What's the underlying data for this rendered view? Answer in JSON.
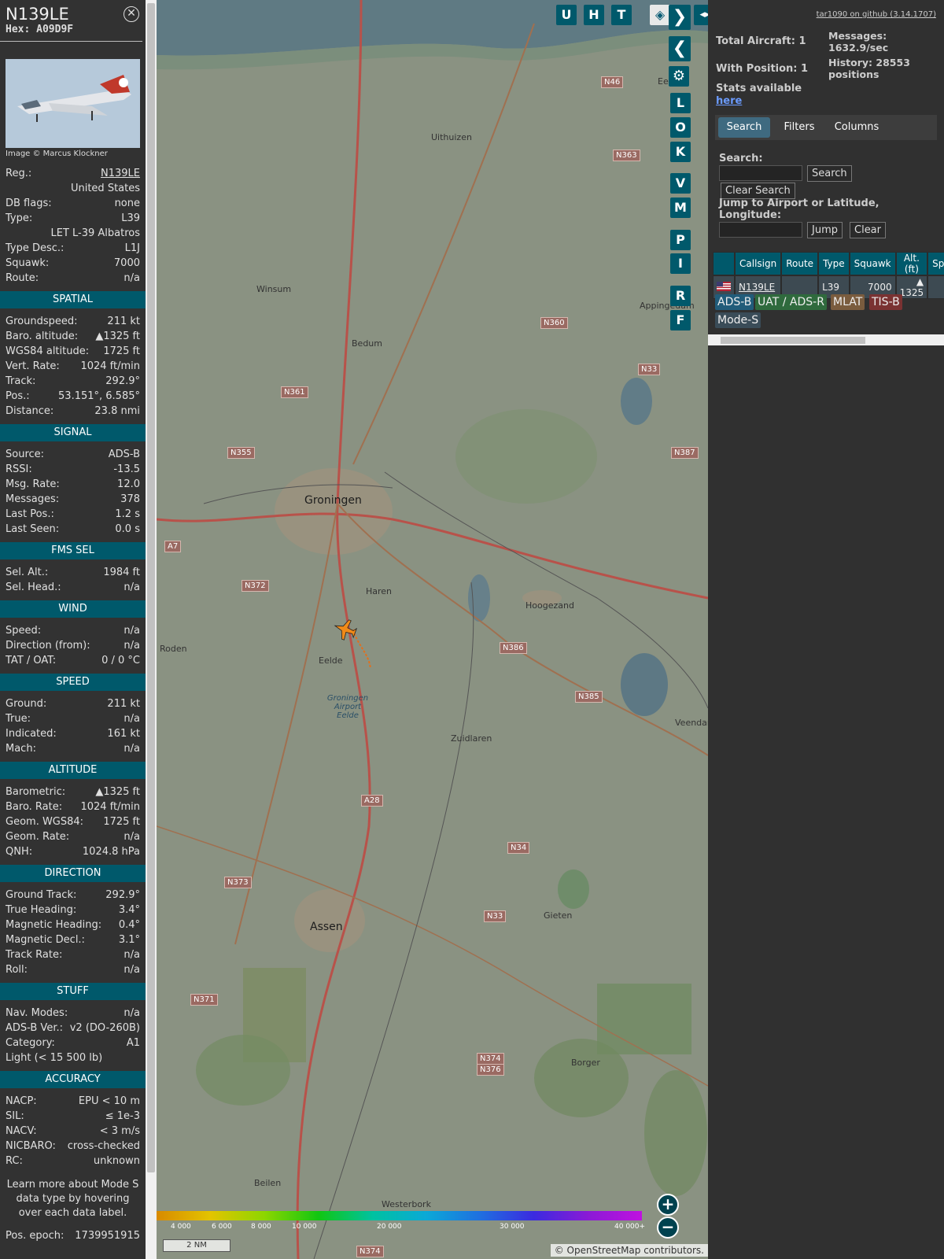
{
  "colors": {
    "accent": "#00596b",
    "panel": "#323232",
    "map_overlay": "#8d9484"
  },
  "aircraft": {
    "callsign": "N139LE",
    "hex_line": "Hex: A09D9F",
    "image_credit": "Image © Marcus Klockner",
    "basic": [
      {
        "k": "Reg.:",
        "v": "N139LE"
      },
      {
        "k": "",
        "v": "United States"
      },
      {
        "k": "DB flags:",
        "v": "none"
      },
      {
        "k": "Type:",
        "v": "L39"
      },
      {
        "k": "",
        "v": "LET L-39 Albatros"
      },
      {
        "k": "Type Desc.:",
        "v": "L1J"
      },
      {
        "k": "Squawk:",
        "v": "7000"
      },
      {
        "k": "Route:",
        "v": "n/a"
      }
    ],
    "sections": [
      {
        "title": "SPATIAL",
        "rows": [
          {
            "k": "Groundspeed:",
            "v": "211 kt"
          },
          {
            "k": "Baro. altitude:",
            "v": "▲1325 ft"
          },
          {
            "k": "WGS84 altitude:",
            "v": "1725 ft"
          },
          {
            "k": "Vert. Rate:",
            "v": "1024 ft/min"
          },
          {
            "k": "Track:",
            "v": "292.9°"
          },
          {
            "k": "Pos.:",
            "v": "53.151°, 6.585°"
          },
          {
            "k": "Distance:",
            "v": "23.8 nmi"
          }
        ]
      },
      {
        "title": "SIGNAL",
        "rows": [
          {
            "k": "Source:",
            "v": "ADS-B"
          },
          {
            "k": "RSSI:",
            "v": "-13.5"
          },
          {
            "k": "Msg. Rate:",
            "v": "12.0"
          },
          {
            "k": "Messages:",
            "v": "378"
          },
          {
            "k": "Last Pos.:",
            "v": "1.2 s"
          },
          {
            "k": "Last Seen:",
            "v": "0.0 s"
          }
        ]
      },
      {
        "title": "FMS SEL",
        "rows": [
          {
            "k": "Sel. Alt.:",
            "v": "1984 ft"
          },
          {
            "k": "Sel. Head.:",
            "v": "n/a"
          }
        ]
      },
      {
        "title": "WIND",
        "rows": [
          {
            "k": "Speed:",
            "v": "n/a"
          },
          {
            "k": "Direction (from):",
            "v": "n/a"
          },
          {
            "k": "TAT / OAT:",
            "v": "0 / 0 °C"
          }
        ]
      },
      {
        "title": "SPEED",
        "rows": [
          {
            "k": "Ground:",
            "v": "211 kt"
          },
          {
            "k": "True:",
            "v": "n/a"
          },
          {
            "k": "Indicated:",
            "v": "161 kt"
          },
          {
            "k": "Mach:",
            "v": "n/a"
          }
        ]
      },
      {
        "title": "ALTITUDE",
        "rows": [
          {
            "k": "Barometric:",
            "v": "▲1325 ft"
          },
          {
            "k": "Baro. Rate:",
            "v": "1024 ft/min"
          },
          {
            "k": "Geom. WGS84:",
            "v": "1725 ft"
          },
          {
            "k": "Geom. Rate:",
            "v": "n/a"
          },
          {
            "k": "QNH:",
            "v": "1024.8 hPa"
          }
        ]
      },
      {
        "title": "DIRECTION",
        "rows": [
          {
            "k": "Ground Track:",
            "v": "292.9°"
          },
          {
            "k": "True Heading:",
            "v": "3.4°"
          },
          {
            "k": "Magnetic Heading:",
            "v": "0.4°"
          },
          {
            "k": "Magnetic Decl.:",
            "v": "3.1°"
          },
          {
            "k": "Track Rate:",
            "v": "n/a"
          },
          {
            "k": "Roll:",
            "v": "n/a"
          }
        ]
      },
      {
        "title": "STUFF",
        "rows": [
          {
            "k": "Nav. Modes:",
            "v": "n/a"
          },
          {
            "k": "ADS-B Ver.:",
            "v": "v2 (DO-260B)"
          },
          {
            "k": "Category:",
            "v": "A1"
          },
          {
            "k": "Light (< 15 500 lb)",
            "v": ""
          }
        ]
      },
      {
        "title": "ACCURACY",
        "rows": [
          {
            "k": "NACP:",
            "v": "EPU < 10 m"
          },
          {
            "k": "SIL:",
            "v": "≤ 1e-3"
          },
          {
            "k": "NACV:",
            "v": "< 3 m/s"
          },
          {
            "k": "NICBARO:",
            "v": "cross-checked"
          },
          {
            "k": "RC:",
            "v": "unknown"
          }
        ]
      }
    ],
    "note": "Learn more about Mode S data type by hovering over each data label.",
    "pos_epoch_label": "Pos. epoch:",
    "pos_epoch_value": "1739951915"
  },
  "map": {
    "top_buttons": [
      "U",
      "H",
      "T"
    ],
    "side_buttons": [
      "L",
      "O",
      "K",
      "V",
      "M",
      "P",
      "I",
      "R",
      "F"
    ],
    "cities": [
      {
        "name": "Groningen"
      },
      {
        "name": "Assen"
      },
      {
        "name": "Hoogezand"
      },
      {
        "name": "Haren"
      },
      {
        "name": "Eelde"
      },
      {
        "name": "Zuidlaren"
      },
      {
        "name": "Veendam"
      },
      {
        "name": "Roden"
      },
      {
        "name": "Winsum"
      },
      {
        "name": "Bedum"
      },
      {
        "name": "Uithuizen"
      },
      {
        "name": "Appingedam"
      },
      {
        "name": "Gieten"
      },
      {
        "name": "Borger"
      },
      {
        "name": "Beilen"
      },
      {
        "name": "Westerbork"
      },
      {
        "name": "Eemsh"
      }
    ],
    "road_labels": [
      "N46",
      "N363",
      "N363",
      "N360",
      "N33",
      "N361",
      "N355",
      "N387",
      "A7",
      "N372",
      "N386",
      "N385",
      "A28",
      "N34",
      "N373",
      "N33",
      "N371",
      "N374",
      "N376",
      "N374"
    ],
    "airport_label": "Groningen Airport Eelde",
    "scale": "2 NM",
    "attribution": "© OpenStreetMap contributors.",
    "altitude_ticks": [
      "4 000",
      "6 000",
      "8 000",
      "10 000",
      "20 000",
      "30 000",
      "40 000+"
    ]
  },
  "side": {
    "github_link": "tar1090 on github (3.14.1707)",
    "total_aircraft": "Total Aircraft: 1",
    "with_position": "With Position: 1",
    "stats_available": "Stats available",
    "stats_link": "here",
    "messages": "Messages: 1632.9/sec",
    "history": "History: 28553 positions",
    "tabs": [
      "Search",
      "Filters",
      "Columns"
    ],
    "search_label": "Search:",
    "search_button": "Search",
    "clear_search_button": "Clear Search",
    "jump_label": "Jump to Airport or Latitude, Longitude:",
    "jump_button": "Jump",
    "clear_button": "Clear",
    "table": {
      "headers": [
        "",
        "Callsign",
        "Route",
        "Type",
        "Squawk",
        "Alt. (ft)",
        "Spd"
      ],
      "row": {
        "flag": "US",
        "callsign": "N139LE",
        "route": "",
        "type": "L39",
        "squawk": "7000",
        "alt": "▲ 1325",
        "spd": ""
      }
    },
    "sources": [
      "ADS-B",
      "UAT / ADS-R",
      "MLAT",
      "TIS-B",
      "Mode-S"
    ]
  }
}
